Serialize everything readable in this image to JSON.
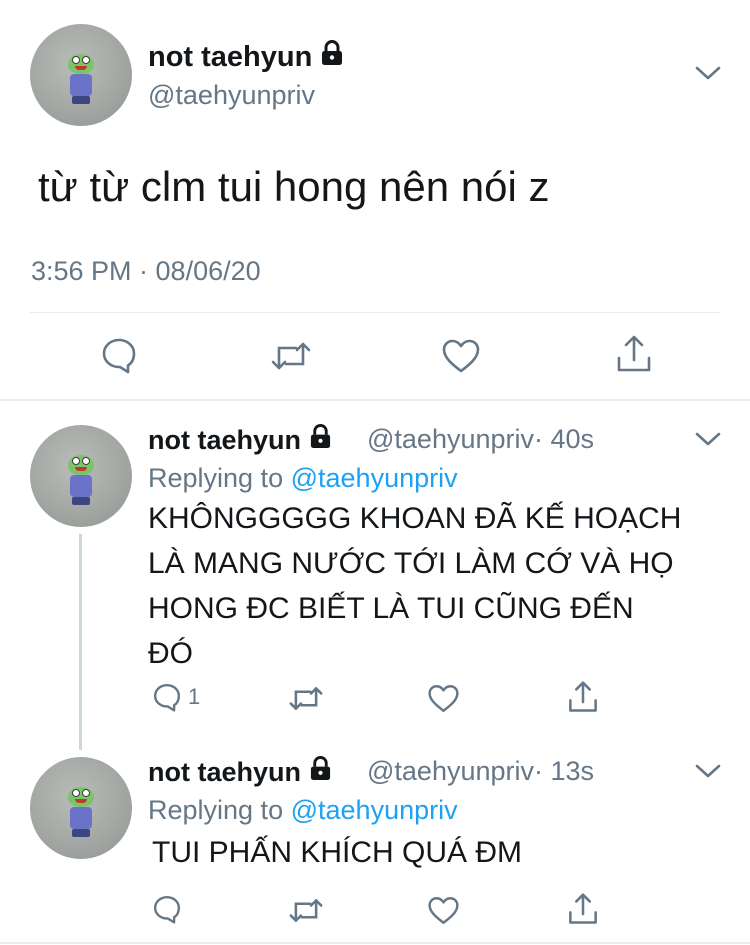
{
  "main_tweet": {
    "name": "not taehyun",
    "handle": "@taehyunpriv",
    "text": "từ từ clm tui hong nên nói z",
    "timestamp": "3:56 PM · 08/06/20"
  },
  "replies": [
    {
      "name": "not taehyun",
      "handle": "@taehyunpriv",
      "time": "· 40s",
      "replying_prefix": "Replying to",
      "replying_to": "@taehyunpriv",
      "lines": [
        "KHÔNGGGGG KHOAN ĐÃ KẾ HOẠCH",
        "LÀ MANG NƯỚC TỚI LÀM CỚ VÀ HỌ",
        "HONG ĐC BIẾT LÀ TUI CŨNG ĐẾN",
        "ĐÓ"
      ],
      "reply_count": "1"
    },
    {
      "name": "not taehyun",
      "handle": "@taehyunpriv",
      "time": "· 13s",
      "replying_prefix": "Replying to",
      "replying_to": "@taehyunpriv",
      "lines": [
        "TUI PHẤN KHÍCH QUÁ ĐM"
      ],
      "reply_count": ""
    }
  ],
  "icons": [
    "lock-icon",
    "chevron-down-icon",
    "reply-icon",
    "retweet-icon",
    "like-icon",
    "share-icon"
  ],
  "colors": {
    "text": "#14171a",
    "secondary": "#657786",
    "link": "#1da1f2",
    "divider": "#e6ecf0"
  }
}
